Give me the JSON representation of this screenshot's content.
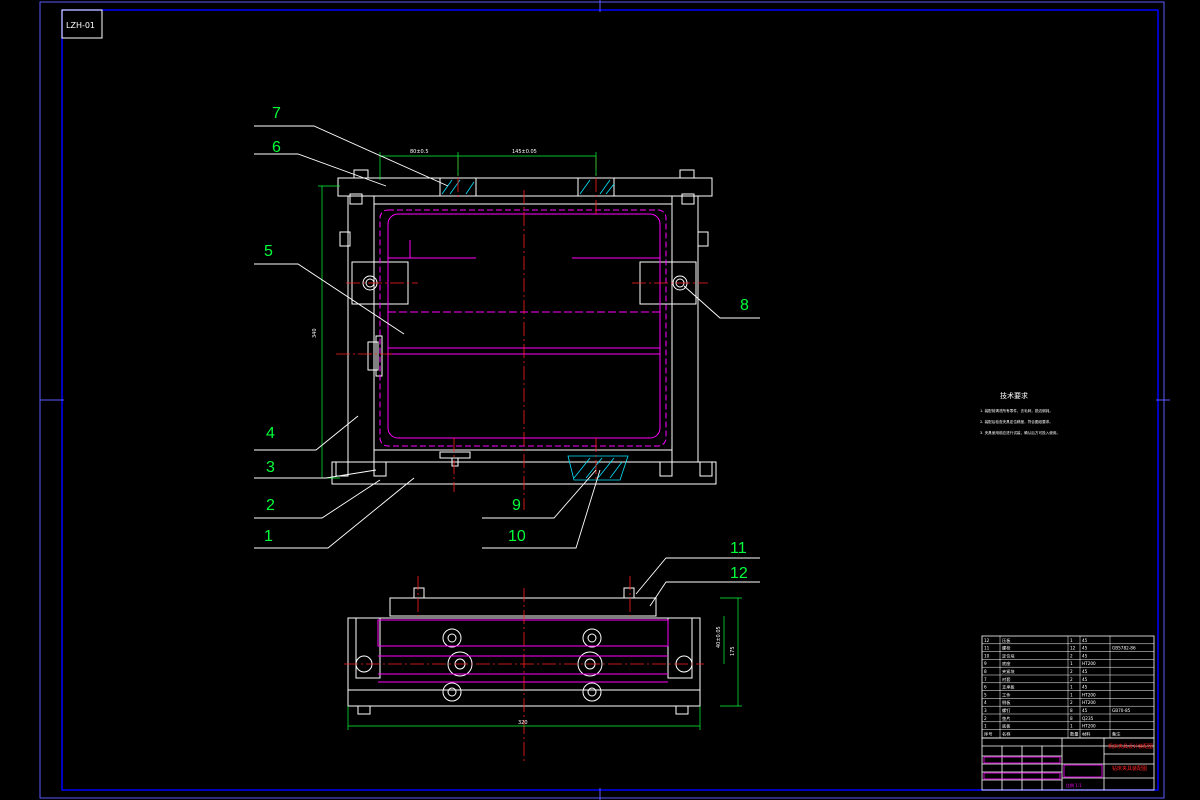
{
  "drawing": {
    "code": "LZH-01",
    "tech_title": "技术要求",
    "tech_notes": [
      "1. 装配前清洗所有零件，去毛刺，锐边倒钝。",
      "2. 装配后检查夹具定位精度，符合图纸要求。",
      "3. 夹具使用前应进行试装，确认后方可投入使用。"
    ]
  },
  "balloons": [
    "7",
    "6",
    "5",
    "4",
    "3",
    "2",
    "1",
    "8",
    "9",
    "10",
    "11",
    "12"
  ],
  "dimensions": {
    "top_a": "80±0.5",
    "top_b": "145±0.05",
    "left_h": "340",
    "side_w": "320",
    "side_h": "175",
    "side_h2": "40±0.05"
  },
  "bom": {
    "rows": [
      {
        "no": "12",
        "name": "压板",
        "qty": "1",
        "mat": "45",
        "std": ""
      },
      {
        "no": "11",
        "name": "螺栓",
        "qty": "12",
        "mat": "45",
        "std": "GB5782-86"
      },
      {
        "no": "10",
        "name": "定位块",
        "qty": "2",
        "mat": "45",
        "std": ""
      },
      {
        "no": "9",
        "name": "底座",
        "qty": "1",
        "mat": "HT200",
        "std": ""
      },
      {
        "no": "8",
        "name": "夹紧块",
        "qty": "2",
        "mat": "45",
        "std": ""
      },
      {
        "no": "7",
        "name": "衬套",
        "qty": "2",
        "mat": "45",
        "std": ""
      },
      {
        "no": "6",
        "name": "支承板",
        "qty": "1",
        "mat": "45",
        "std": ""
      },
      {
        "no": "5",
        "name": "工件",
        "qty": "1",
        "mat": "HT200",
        "std": ""
      },
      {
        "no": "4",
        "name": "侧板",
        "qty": "2",
        "mat": "HT200",
        "std": ""
      },
      {
        "no": "3",
        "name": "螺钉",
        "qty": "8",
        "mat": "45",
        "std": "GB70-85"
      },
      {
        "no": "2",
        "name": "垫片",
        "qty": "8",
        "mat": "Q235",
        "std": ""
      },
      {
        "no": "1",
        "name": "底板",
        "qty": "1",
        "mat": "HT200",
        "std": ""
      }
    ],
    "header": [
      "序号",
      "名称",
      "数量",
      "材料",
      "备注"
    ],
    "title_red": "机床夹具设计装配图",
    "subtitle_red": "钻床夹具装配图",
    "scale_label": "比例 1:1"
  },
  "colors": {
    "frame": "#0000ff",
    "outline": "#ffffff",
    "hidden": "#ff00ff",
    "center": "#ff2020",
    "balloon": "#00ff3a",
    "dim": "#00ff3a",
    "hatch": "#00e5ff"
  }
}
